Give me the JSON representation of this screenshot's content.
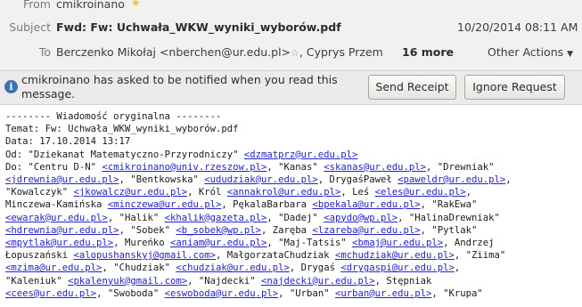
{
  "header": {
    "from_label": "From",
    "from_value": "cmikroinano",
    "subject_label": "Subject",
    "subject_value": "Fwd: Fw: Uchwała_WKW_wyniki_wyborów.pdf",
    "date": "10/20/2014 08:11 AM",
    "to_label": "To",
    "to_value": "Berczenko Mikołaj <nberchen@ur.edu.pl>",
    "to_value_2": ", Cyprys Przem",
    "more": "16 more",
    "other_actions": "Other Actions"
  },
  "notice": {
    "text": "cmikroinano has asked to be notified when you read this message.",
    "send_receipt": "Send Receipt",
    "ignore_request": "Ignore Request"
  },
  "body_lines": [
    {
      "segs": [
        {
          "t": "-------- Wiadomość oryginalna --------"
        }
      ]
    },
    {
      "segs": [
        {
          "t": "Temat: Fw: Uchwała_WKW_wyniki_wyborów.pdf"
        }
      ]
    },
    {
      "segs": [
        {
          "t": "Data: 17.10.2014 13:17"
        }
      ]
    },
    {
      "segs": [
        {
          "t": "Od: \"Dziekanat Matematyczno-Przyrodniczy\" "
        },
        {
          "t": "<dzmatprz@ur.edu.pl>",
          "l": 1
        }
      ]
    },
    {
      "segs": [
        {
          "t": "Do: \"Centru D-N\" "
        },
        {
          "t": "<cmikroinano@univ.rzeszow.pl>",
          "l": 1
        },
        {
          "t": ", \"Kanas\" "
        },
        {
          "t": "<skanas@ur.edu.pl>",
          "l": 1
        },
        {
          "t": ", \"Drewniak\""
        }
      ]
    },
    {
      "segs": [
        {
          "t": "<jdrewnia@ur.edu.pl>",
          "l": 1
        },
        {
          "t": ", \"Bentkowska\" "
        },
        {
          "t": "<ududziak@ur.edu.pl>",
          "l": 1
        },
        {
          "t": ", DrygaśPaweł "
        },
        {
          "t": "<paweldr@ur.edu.pl>",
          "l": 1
        },
        {
          "t": ","
        }
      ]
    },
    {
      "segs": [
        {
          "t": "\"Kowalczyk\" "
        },
        {
          "t": "<jkowalcz@ur.edu.pl>",
          "l": 1
        },
        {
          "t": ", Król "
        },
        {
          "t": "<annakrol@ur.edu.pl>",
          "l": 1
        },
        {
          "t": ", Leś "
        },
        {
          "t": "<eles@ur.edu.pl>",
          "l": 1
        },
        {
          "t": ","
        }
      ]
    },
    {
      "segs": [
        {
          "t": "Minczewa-Kamińska "
        },
        {
          "t": "<minczewa@ur.edu.pl>",
          "l": 1
        },
        {
          "t": ", PękalaBarbara "
        },
        {
          "t": "<bpekala@ur.edu.pl>",
          "l": 1
        },
        {
          "t": ", \"RakEwa\""
        }
      ]
    },
    {
      "segs": [
        {
          "t": "<ewarak@ur.edu.pl>",
          "l": 1
        },
        {
          "t": ", \"Halik\" "
        },
        {
          "t": "<khalik@gazeta.pl>",
          "l": 1
        },
        {
          "t": ", \"Dadej\" "
        },
        {
          "t": "<apydo@wp.pl>",
          "l": 1
        },
        {
          "t": ", \"HalinaDrewniak\""
        }
      ]
    },
    {
      "segs": [
        {
          "t": "<hdrewnia@ur.edu.pl>",
          "l": 1
        },
        {
          "t": ", \"Sobek\" "
        },
        {
          "t": "<b_sobek@wp.pl>",
          "l": 1
        },
        {
          "t": ", Zaręba "
        },
        {
          "t": "<lzareba@ur.edu.pl>",
          "l": 1
        },
        {
          "t": ", \"Pytlak\""
        }
      ]
    },
    {
      "segs": [
        {
          "t": "<mpytlak@ur.edu.pl>",
          "l": 1
        },
        {
          "t": ", Mureńko "
        },
        {
          "t": "<aniam@ur.edu.pl>",
          "l": 1
        },
        {
          "t": ", \"Maj-Tatsis\" "
        },
        {
          "t": "<bmaj@ur.edu.pl>",
          "l": 1
        },
        {
          "t": ", Andrzej"
        }
      ]
    },
    {
      "segs": [
        {
          "t": "Łopuszański "
        },
        {
          "t": "<alopushanskyj@gmail.com>",
          "l": 1
        },
        {
          "t": ", MałgorzataChudziak "
        },
        {
          "t": "<mchudziak@ur.edu.pl>",
          "l": 1
        },
        {
          "t": ", \"Ziima\""
        }
      ]
    },
    {
      "segs": [
        {
          "t": "<mzima@ur.edu.pl>",
          "l": 1
        },
        {
          "t": ", \"Chudziak\" "
        },
        {
          "t": "<chudziak@ur.edu.pl>",
          "l": 1
        },
        {
          "t": ", Drygaś "
        },
        {
          "t": "<drygaspi@ur.edu.pl>",
          "l": 1
        },
        {
          "t": ","
        }
      ]
    },
    {
      "segs": [
        {
          "t": "\"Kaleniuk\" "
        },
        {
          "t": "<pkalenyuk@gmail.com>",
          "l": 1
        },
        {
          "t": ", \"Najdecki\" "
        },
        {
          "t": "<najdecki@ur.edu.pl>",
          "l": 1
        },
        {
          "t": ", Stępniak"
        }
      ]
    },
    {
      "segs": [
        {
          "t": "<cees@ur.edu.pl>",
          "l": 1
        },
        {
          "t": ", \"Swoboda\" "
        },
        {
          "t": "<eswoboda@ur.edu.pl>",
          "l": 1
        },
        {
          "t": ", \"Urban\" "
        },
        {
          "t": "<urban@ur.edu.pl>",
          "l": 1
        },
        {
          "t": ", \"Krupa\""
        }
      ]
    }
  ]
}
